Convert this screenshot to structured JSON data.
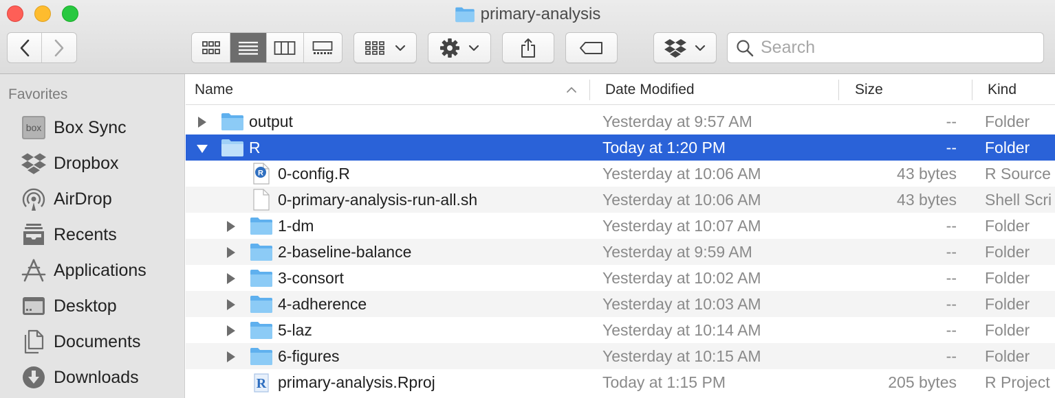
{
  "window": {
    "title": "primary-analysis"
  },
  "toolbar": {
    "search_placeholder": "Search",
    "view_modes": [
      "icon-view",
      "list-view",
      "column-view",
      "gallery-view"
    ],
    "active_view": "list-view"
  },
  "sidebar": {
    "heading": "Favorites",
    "items": [
      {
        "label": "Box Sync",
        "icon": "box-sync-icon"
      },
      {
        "label": "Dropbox",
        "icon": "dropbox-icon"
      },
      {
        "label": "AirDrop",
        "icon": "airdrop-icon"
      },
      {
        "label": "Recents",
        "icon": "recents-icon"
      },
      {
        "label": "Applications",
        "icon": "applications-icon"
      },
      {
        "label": "Desktop",
        "icon": "desktop-icon"
      },
      {
        "label": "Documents",
        "icon": "documents-icon"
      },
      {
        "label": "Downloads",
        "icon": "downloads-icon"
      }
    ]
  },
  "columns": {
    "name": "Name",
    "date": "Date Modified",
    "size": "Size",
    "kind": "Kind"
  },
  "rows": [
    {
      "name": "output",
      "date": "Yesterday at 9:57 AM",
      "size": "--",
      "kind": "Folder",
      "type": "folder",
      "level": 0,
      "expanded": false
    },
    {
      "name": "R",
      "date": "Today at 1:20 PM",
      "size": "--",
      "kind": "Folder",
      "type": "folder",
      "level": 0,
      "expanded": true,
      "selected": true
    },
    {
      "name": "0-config.R",
      "date": "Yesterday at 10:06 AM",
      "size": "43 bytes",
      "kind": "R Source",
      "type": "r-source",
      "level": 1
    },
    {
      "name": "0-primary-analysis-run-all.sh",
      "date": "Yesterday at 10:06 AM",
      "size": "43 bytes",
      "kind": "Shell Scri",
      "type": "document",
      "level": 1
    },
    {
      "name": "1-dm",
      "date": "Yesterday at 10:07 AM",
      "size": "--",
      "kind": "Folder",
      "type": "folder",
      "level": 1,
      "expanded": false
    },
    {
      "name": "2-baseline-balance",
      "date": "Yesterday at 9:59 AM",
      "size": "--",
      "kind": "Folder",
      "type": "folder",
      "level": 1,
      "expanded": false
    },
    {
      "name": "3-consort",
      "date": "Yesterday at 10:02 AM",
      "size": "--",
      "kind": "Folder",
      "type": "folder",
      "level": 1,
      "expanded": false
    },
    {
      "name": "4-adherence",
      "date": "Yesterday at 10:03 AM",
      "size": "--",
      "kind": "Folder",
      "type": "folder",
      "level": 1,
      "expanded": false
    },
    {
      "name": "5-laz",
      "date": "Yesterday at 10:14 AM",
      "size": "--",
      "kind": "Folder",
      "type": "folder",
      "level": 1,
      "expanded": false
    },
    {
      "name": "6-figures",
      "date": "Yesterday at 10:15 AM",
      "size": "--",
      "kind": "Folder",
      "type": "folder",
      "level": 1,
      "expanded": false
    },
    {
      "name": "primary-analysis.Rproj",
      "date": "Today at 1:15 PM",
      "size": "205 bytes",
      "kind": "R Project",
      "type": "r-project",
      "level": 1
    }
  ],
  "colors": {
    "selection": "#2a62d8",
    "folder": "#6bb7ef",
    "sidebar_bg": "#e4e4e4"
  }
}
